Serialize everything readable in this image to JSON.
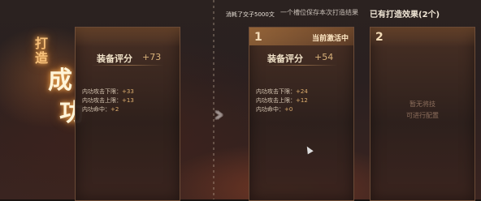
{
  "top": {
    "consumed_note": "消耗了交子5000文",
    "hint": "一个槽位保存本次打造结果",
    "existing_title": "已有打造效果(2个)"
  },
  "success": {
    "small_1": "打",
    "small_2": "造",
    "big_1": "成",
    "big_2": "功"
  },
  "left_panel": {
    "score_label": "装备评分",
    "score_value": "+73",
    "attrs": [
      {
        "label": "内功攻击下限：",
        "value": "+33"
      },
      {
        "label": "内功攻击上限：",
        "value": "+13"
      },
      {
        "label": "内功命中：",
        "value": "+2"
      }
    ]
  },
  "slot1": {
    "number": "1",
    "status": "当前激活中",
    "score_label": "装备评分",
    "score_value": "+54",
    "attrs": [
      {
        "label": "内功攻击下限：",
        "value": "+24"
      },
      {
        "label": "内功攻击上限：",
        "value": "+12"
      },
      {
        "label": "内功命中：",
        "value": "+0"
      }
    ]
  },
  "slot2": {
    "number": "2",
    "empty_line_1": "暂无将技",
    "empty_line_2": "可进行配置"
  },
  "arrows": "›››"
}
